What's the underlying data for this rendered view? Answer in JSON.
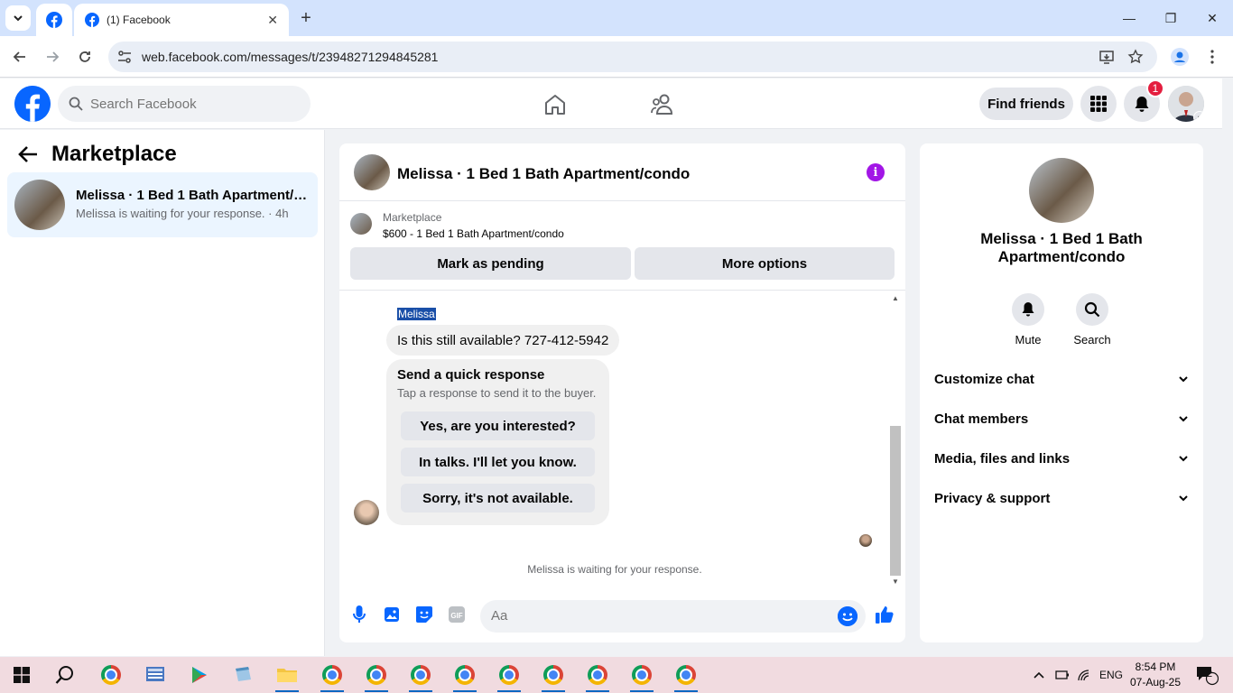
{
  "browser": {
    "tab_title": "(1) Facebook",
    "url": "web.facebook.com/messages/t/23948271294845281"
  },
  "fb_header": {
    "search_placeholder": "Search Facebook",
    "find_friends_label": "Find friends",
    "notification_count": "1"
  },
  "left_panel": {
    "title": "Marketplace",
    "conversations": [
      {
        "name": "Melissa · 1 Bed 1 Bath Apartment/c...",
        "preview": "Melissa is waiting for your response. · 4h"
      }
    ]
  },
  "chat": {
    "title": "Melissa · 1 Bed 1 Bath Apartment/condo",
    "marketplace_label": "Marketplace",
    "listing": "$600 - 1 Bed 1 Bath Apartment/condo",
    "mark_pending_label": "Mark as pending",
    "more_options_label": "More options",
    "sender_name": "Melissa",
    "message": "Is this still available? 727-412-5942",
    "quick_response_title": "Send a quick response",
    "quick_response_subtitle": "Tap a response to send it to the buyer.",
    "quick_responses": [
      "Yes, are you interested?",
      "In talks. I'll let you know.",
      "Sorry, it's not available."
    ],
    "waiting_note": "Melissa is waiting for your response.",
    "composer_placeholder": "Aa"
  },
  "right_panel": {
    "name": "Melissa · 1 Bed 1 Bath Apartment/condo",
    "mute_label": "Mute",
    "search_label": "Search",
    "sections": [
      "Customize chat",
      "Chat members",
      "Media, files and links",
      "Privacy & support"
    ]
  },
  "taskbar": {
    "language": "ENG",
    "time": "8:54 PM",
    "date": "07-Aug-25",
    "notification_count": "2"
  },
  "colors": {
    "fb_blue": "#0866ff",
    "selected_convo": "#ebf5ff",
    "info_purple": "#a216e6",
    "badge_red": "#e41e3f"
  }
}
